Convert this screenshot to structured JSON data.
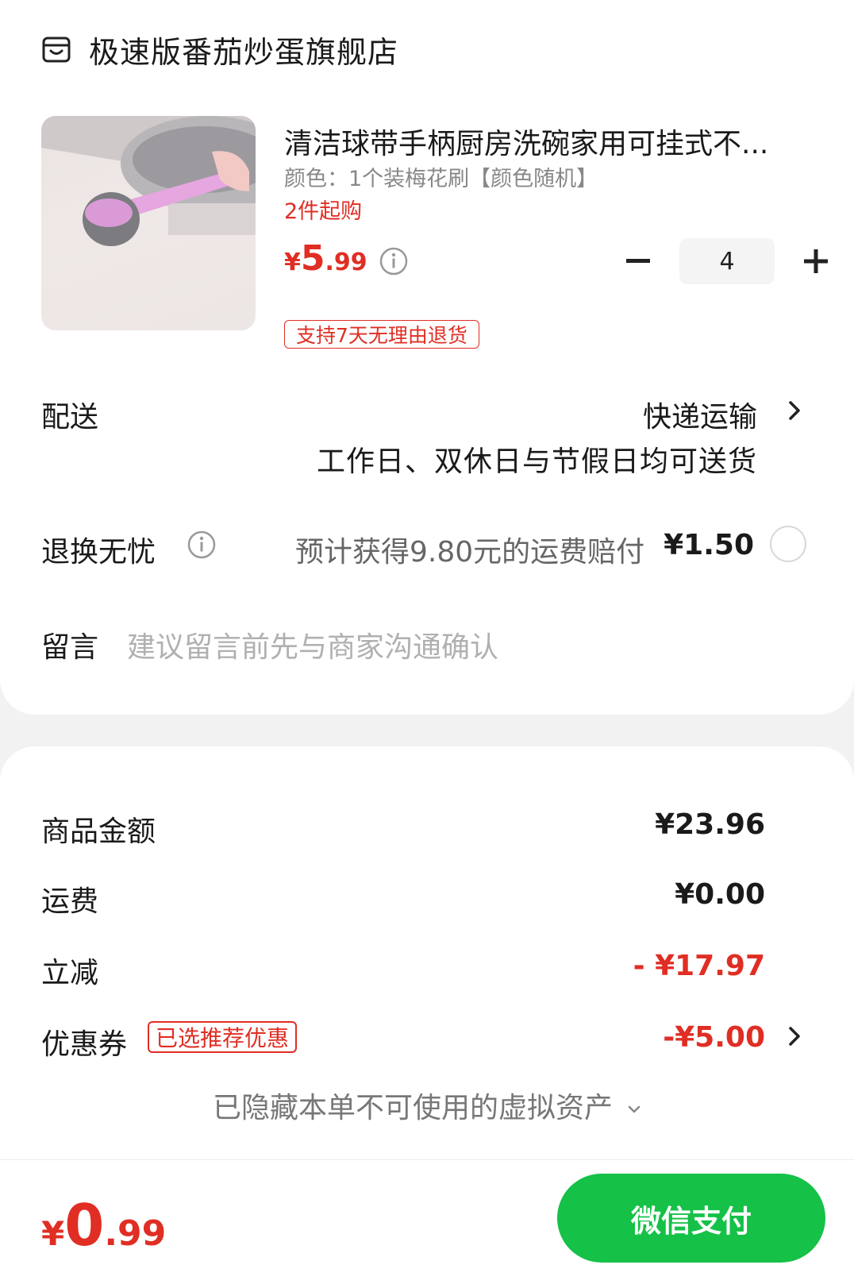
{
  "store": {
    "name": "极速版番茄炒蛋旗舰店",
    "icon": "store-icon"
  },
  "product": {
    "title": "清洁球带手柄厨房洗碗家用可挂式不...",
    "spec": "颜色：1个装梅花刷【颜色随机】",
    "min_purchase": "2件起购",
    "price_currency": "¥",
    "price_int": "5",
    "price_dec": ".99",
    "quantity": "4",
    "return_badge": "支持7天无理由退货"
  },
  "delivery": {
    "label": "配送",
    "method": "快递运输",
    "desc": "工作日、双休日与节假日均可送货"
  },
  "return_worry": {
    "label": "退换无忧",
    "desc": "预计获得9.80元的运费赔付",
    "fee": "¥1.50"
  },
  "message": {
    "label": "留言",
    "placeholder": "建议留言前先与商家沟通确认"
  },
  "summary": {
    "goods_label": "商品金额",
    "goods_value": "¥23.96",
    "shipping_label": "运费",
    "shipping_value": "¥0.00",
    "discount_label": "立减",
    "discount_value": "- ¥17.97",
    "coupon_label": "优惠券",
    "coupon_badge": "已选推荐优惠",
    "coupon_value": "-¥5.00",
    "hidden_note": "已隐藏本单不可使用的虚拟资产"
  },
  "footer": {
    "total_currency": "¥",
    "total_int": "0",
    "total_dec": ".99",
    "pay_label": "微信支付"
  },
  "colors": {
    "accent_red": "#e02e24",
    "pay_green": "#15c147"
  }
}
